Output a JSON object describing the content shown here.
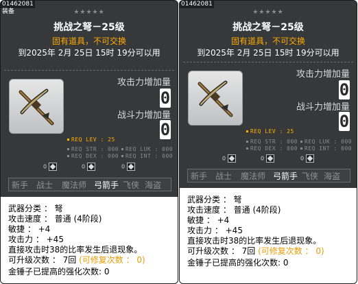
{
  "colors": {
    "background": "#36383a",
    "untradable": "#ffaa00",
    "req_lev": "#ffb300",
    "upgrade_note": "#e89b00",
    "info_bg": "#ffffff"
  },
  "tooltips": [
    {
      "id_tag": "01462081",
      "sub_tag": "装备",
      "stars": "★★★★★",
      "title": "挑战之弩－25级",
      "untradable": "固有道具，不可交换",
      "expiry": "到2025年 2月 25日 15时 19分可以用",
      "icon": "crossbow-icon",
      "attack_label": "攻击力增加量",
      "attack_value": "0",
      "combat_label": "战斗力增加量",
      "combat_value": "0",
      "req_lev": "REQ LEV :  25",
      "req_str": "REQ STR : 000",
      "req_dex": "REQ DEX : 000",
      "req_luk": "REQ LUK : 000",
      "req_int": "REQ INT : 000",
      "elements": [
        "0",
        "0",
        "0"
      ],
      "jobs": [
        "新手",
        "战士",
        "魔法师",
        "弓箭手",
        "飞侠",
        "海盗"
      ],
      "active_job": "弓箭手",
      "info": {
        "category": "武器分类 ： 弩",
        "speed": "攻击速度 ： 普通 (4阶段)",
        "dex": "敏捷 ： +4",
        "attack": "攻击力 ： +45",
        "knockback": "直接攻击时38的比率发生后退现象。",
        "upgrades": "可升级次数 ： 7回",
        "repair": "(可修复次数 ： 0)",
        "hammer": "金锤子已提高的强化次数: 0"
      }
    },
    {
      "id_tag": "01462081",
      "sub_tag": "",
      "stars": "★★★★★",
      "title": "挑战之弩－25级",
      "untradable": "固有道具，不可交换",
      "expiry": "到2025年 2月 25日 15时 19分可以用",
      "icon": "crossbow-icon",
      "attack_label": "攻击力增加量",
      "attack_value": "0",
      "combat_label": "战斗力增加量",
      "combat_value": "0",
      "req_lev": "REQ LEV :  25",
      "req_str": "REQ STR : 000",
      "req_dex": "REQ DEX : 000",
      "req_luk": "REQ LUK : 000",
      "req_int": "REQ INT : 000",
      "elements": [
        "0",
        "0",
        "0"
      ],
      "jobs": [
        "新手",
        "战士",
        "魔法师",
        "弓箭手",
        "飞侠",
        "海盗"
      ],
      "active_job": "弓箭手",
      "info": {
        "category": "武器分类 ： 弩",
        "speed": "攻击速度 ： 普通 (4阶段)",
        "dex": "敏捷 ： +4",
        "attack": "攻击力 ： +45",
        "knockback": "直接攻击时38的比率发生后退现象。",
        "upgrades": "可升级次数 ： 7回",
        "repair": "(可修复次数 ： 0)",
        "hammer": "金锤子已提高的强化次数: 0"
      }
    }
  ]
}
